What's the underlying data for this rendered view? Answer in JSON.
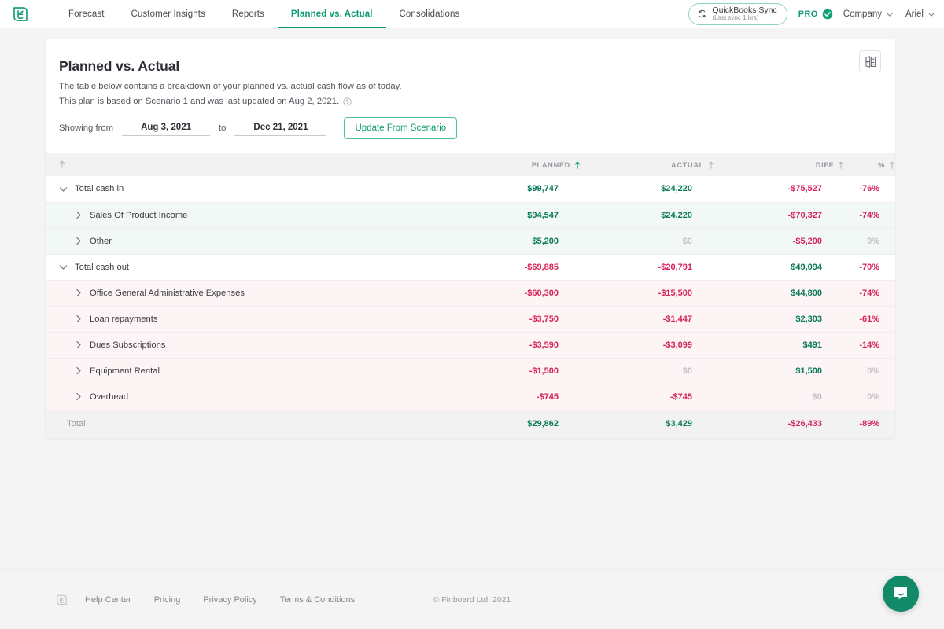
{
  "nav": {
    "logo_icon": "finboard-leaf-logo",
    "links": [
      {
        "label": "Forecast",
        "active": false
      },
      {
        "label": "Customer Insights",
        "active": false
      },
      {
        "label": "Reports",
        "active": false
      },
      {
        "label": "Planned vs. Actual",
        "active": true
      },
      {
        "label": "Consolidations",
        "active": false
      }
    ],
    "quickbooks": {
      "title": "QuickBooks Sync",
      "subtitle": "(Last sync 1 hrs)",
      "icon": "sync-refresh-icon"
    },
    "pro_label": "PRO",
    "pro_icon": "check-circle-icon",
    "company_label": "Company",
    "user_label": "Ariel",
    "caret_icon": "chevron-down-icon"
  },
  "card": {
    "title": "Planned vs. Actual",
    "description_line1": "The table below contains a breakdown of your planned vs. actual cash flow as of today.",
    "description_line2": "This plan is based on Scenario 1 and was last updated on Aug 2, 2021.",
    "info_icon": "help-circle-icon",
    "export_icon": "export-panel-icon",
    "filters": {
      "showing_from_label": "Showing from",
      "date_from": "Aug 3, 2021",
      "to_label": "to",
      "date_to": "Dec 21, 2021",
      "update_button": "Update From Scenario"
    }
  },
  "table": {
    "columns": [
      {
        "key": "name",
        "label": "",
        "sorted": false,
        "align": "left"
      },
      {
        "key": "planned",
        "label": "PLANNED",
        "sorted": true,
        "align": "right"
      },
      {
        "key": "actual",
        "label": "ACTUAL",
        "sorted": false,
        "align": "right"
      },
      {
        "key": "diff",
        "label": "DIFF",
        "sorted": false,
        "align": "right"
      },
      {
        "key": "pct",
        "label": "%",
        "sorted": false,
        "align": "right"
      }
    ],
    "sort_arrow_icon": "arrow-up-icon",
    "rows": [
      {
        "name": "Total cash in",
        "level": "parent",
        "group": "in",
        "expanded": true,
        "chevron": "chevron-down-icon",
        "planned": "$99,747",
        "planned_tone": "pos",
        "actual": "$24,220",
        "actual_tone": "pos",
        "diff": "-$75,527",
        "diff_tone": "neg",
        "pct": "-76%",
        "pct_tone": "neg"
      },
      {
        "name": "Sales Of Product Income",
        "level": "child",
        "group": "in",
        "expanded": false,
        "chevron": "chevron-right-icon",
        "planned": "$94,547",
        "planned_tone": "pos",
        "actual": "$24,220",
        "actual_tone": "pos",
        "diff": "-$70,327",
        "diff_tone": "neg",
        "pct": "-74%",
        "pct_tone": "neg"
      },
      {
        "name": "Other",
        "level": "child",
        "group": "in",
        "expanded": false,
        "chevron": "chevron-right-icon",
        "planned": "$5,200",
        "planned_tone": "pos",
        "actual": "$0",
        "actual_tone": "zero",
        "diff": "-$5,200",
        "diff_tone": "neg",
        "pct": "0%",
        "pct_tone": "zero"
      },
      {
        "name": "Total cash out",
        "level": "parent",
        "group": "out",
        "expanded": true,
        "chevron": "chevron-down-icon",
        "planned": "-$69,885",
        "planned_tone": "neg",
        "actual": "-$20,791",
        "actual_tone": "neg",
        "diff": "$49,094",
        "diff_tone": "pos",
        "pct": "-70%",
        "pct_tone": "neg"
      },
      {
        "name": "Office General Administrative Expenses",
        "level": "child",
        "group": "out",
        "expanded": false,
        "chevron": "chevron-right-icon",
        "planned": "-$60,300",
        "planned_tone": "neg",
        "actual": "-$15,500",
        "actual_tone": "neg",
        "diff": "$44,800",
        "diff_tone": "pos",
        "pct": "-74%",
        "pct_tone": "neg"
      },
      {
        "name": "Loan repayments",
        "level": "child",
        "group": "out",
        "expanded": false,
        "chevron": "chevron-right-icon",
        "planned": "-$3,750",
        "planned_tone": "neg",
        "actual": "-$1,447",
        "actual_tone": "neg",
        "diff": "$2,303",
        "diff_tone": "pos",
        "pct": "-61%",
        "pct_tone": "neg"
      },
      {
        "name": "Dues Subscriptions",
        "level": "child",
        "group": "out",
        "expanded": false,
        "chevron": "chevron-right-icon",
        "planned": "-$3,590",
        "planned_tone": "neg",
        "actual": "-$3,099",
        "actual_tone": "neg",
        "diff": "$491",
        "diff_tone": "pos",
        "pct": "-14%",
        "pct_tone": "neg"
      },
      {
        "name": "Equipment Rental",
        "level": "child",
        "group": "out",
        "expanded": false,
        "chevron": "chevron-right-icon",
        "planned": "-$1,500",
        "planned_tone": "neg",
        "actual": "$0",
        "actual_tone": "zero",
        "diff": "$1,500",
        "diff_tone": "pos",
        "pct": "0%",
        "pct_tone": "zero"
      },
      {
        "name": "Overhead",
        "level": "child",
        "group": "out",
        "expanded": false,
        "chevron": "chevron-right-icon",
        "planned": "-$745",
        "planned_tone": "neg",
        "actual": "-$745",
        "actual_tone": "neg",
        "diff": "$0",
        "diff_tone": "zero",
        "pct": "0%",
        "pct_tone": "zero"
      },
      {
        "name": "Total",
        "level": "total",
        "group": "total",
        "expanded": false,
        "chevron": "",
        "planned": "$29,862",
        "planned_tone": "pos",
        "actual": "$3,429",
        "actual_tone": "pos",
        "diff": "-$26,433",
        "diff_tone": "neg",
        "pct": "-89%",
        "pct_tone": "neg"
      }
    ]
  },
  "footer": {
    "logo_icon": "finboard-leaf-logo",
    "links": [
      "Help Center",
      "Pricing",
      "Privacy Policy",
      "Terms & Conditions"
    ],
    "copyright": "© Finboard Ltd. 2021"
  },
  "chat": {
    "icon": "chat-bubble-icon"
  },
  "colors": {
    "brand_green": "#0f9b74",
    "value_positive": "#0b7a5a",
    "value_negative": "#d6255b",
    "value_zero": "#c2c2c8",
    "page_background": "#f4f4f5",
    "row_in_background": "#f1f8f5",
    "row_out_background": "#fdf4f6"
  }
}
